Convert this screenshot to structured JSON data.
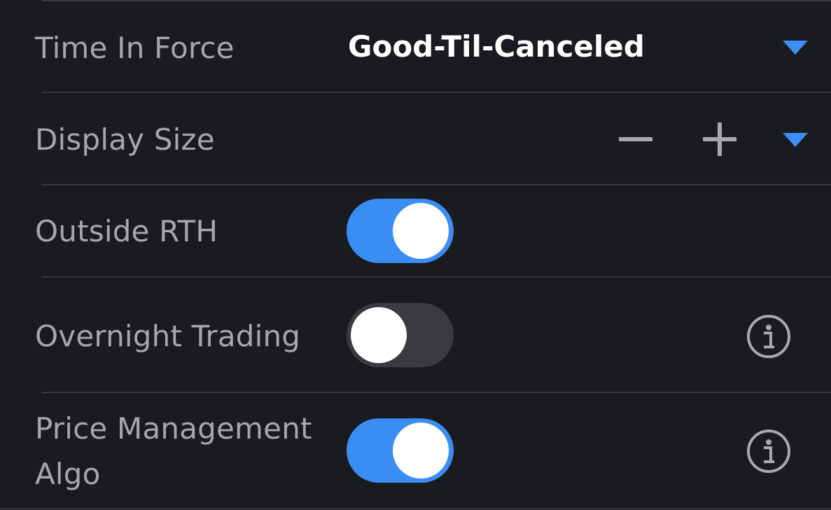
{
  "rows": {
    "time_in_force": {
      "label": "Time In Force",
      "value": "Good-Til-Canceled"
    },
    "display_size": {
      "label": "Display Size"
    },
    "outside_rth": {
      "label": "Outside RTH",
      "enabled": true
    },
    "overnight_trading": {
      "label": "Overnight Trading",
      "enabled": false
    },
    "price_management_algo": {
      "label": "Price Management Algo",
      "enabled": true
    }
  },
  "colors": {
    "accent": "#3d8ff5",
    "background": "#1a1b20",
    "label": "#a6a7ac",
    "toggle_off": "#3a3b41"
  },
  "icons": {
    "dropdown": "caret-down-icon",
    "decrement": "minus-icon",
    "increment": "plus-icon",
    "info": "info-icon"
  }
}
